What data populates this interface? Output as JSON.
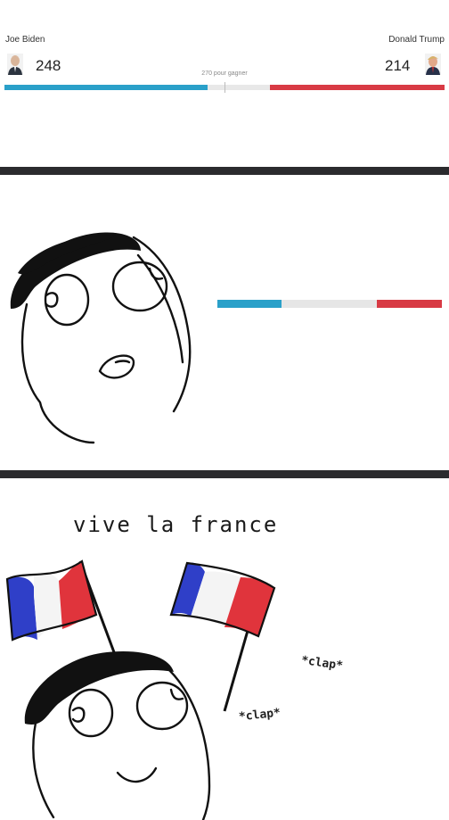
{
  "scoreboard": {
    "left_candidate": "Joe Biden",
    "left_votes": "248",
    "right_candidate": "Donald Trump",
    "right_votes": "214",
    "threshold_label": "270 pour gagner",
    "colors": {
      "blue": "#2aa0c9",
      "red": "#d83a44",
      "neutral": "#e8e8e8"
    }
  },
  "panel3": {
    "caption": "vive la france",
    "clap_1": "*clap*",
    "clap_2": "*clap*"
  },
  "icons": [
    "candidate-portrait-icon",
    "french-flag-icon"
  ]
}
